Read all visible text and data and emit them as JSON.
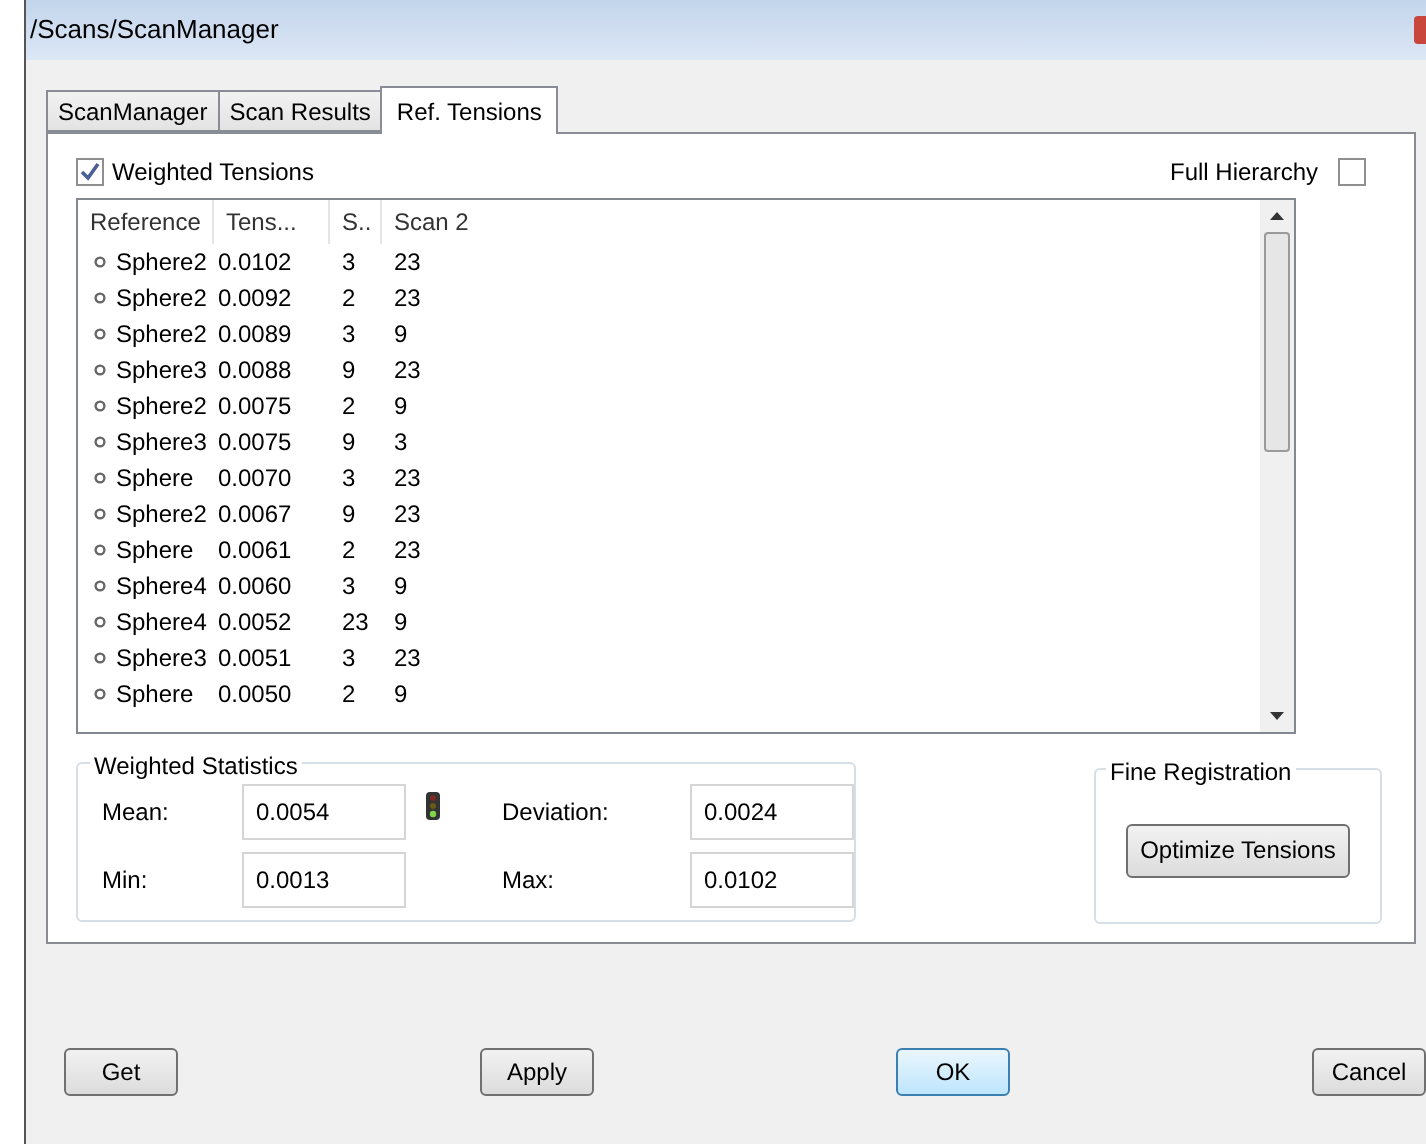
{
  "window": {
    "title": "/Scans/ScanManager"
  },
  "tabs": [
    {
      "label": "ScanManager",
      "selected": false
    },
    {
      "label": "Scan Results",
      "selected": false
    },
    {
      "label": "Ref. Tensions",
      "selected": true
    }
  ],
  "weighted_tensions": {
    "label": "Weighted Tensions",
    "checked": true
  },
  "full_hierarchy": {
    "label": "Full Hierarchy",
    "checked": false
  },
  "table": {
    "columns": [
      "Reference",
      "Tens...",
      "S..",
      "Scan 2"
    ],
    "rows": [
      [
        "Sphere2",
        "0.0102",
        "3",
        "23"
      ],
      [
        "Sphere2",
        "0.0092",
        "2",
        "23"
      ],
      [
        "Sphere2",
        "0.0089",
        "3",
        "9"
      ],
      [
        "Sphere3",
        "0.0088",
        "9",
        "23"
      ],
      [
        "Sphere2",
        "0.0075",
        "2",
        "9"
      ],
      [
        "Sphere3",
        "0.0075",
        "9",
        "3"
      ],
      [
        "Sphere",
        "0.0070",
        "3",
        "23"
      ],
      [
        "Sphere2",
        "0.0067",
        "9",
        "23"
      ],
      [
        "Sphere",
        "0.0061",
        "2",
        "23"
      ],
      [
        "Sphere4",
        "0.0060",
        "3",
        "9"
      ],
      [
        "Sphere4",
        "0.0052",
        "23",
        "9"
      ],
      [
        "Sphere3",
        "0.0051",
        "3",
        "23"
      ],
      [
        "Sphere",
        "0.0050",
        "2",
        "9"
      ]
    ]
  },
  "weighted_statistics": {
    "title": "Weighted Statistics",
    "fields": [
      {
        "label": "Mean:",
        "value": "0.0054"
      },
      {
        "label": "Deviation:",
        "value": "0.0024"
      },
      {
        "label": "Min:",
        "value": "0.0013"
      },
      {
        "label": "Max:",
        "value": "0.0102"
      }
    ]
  },
  "fine_registration": {
    "title": "Fine Registration",
    "button": "Optimize Tensions"
  },
  "buttons": [
    {
      "label": "Get",
      "default": false
    },
    {
      "label": "Apply",
      "default": false
    },
    {
      "label": "OK",
      "default": true
    },
    {
      "label": "Cancel",
      "default": false
    }
  ]
}
